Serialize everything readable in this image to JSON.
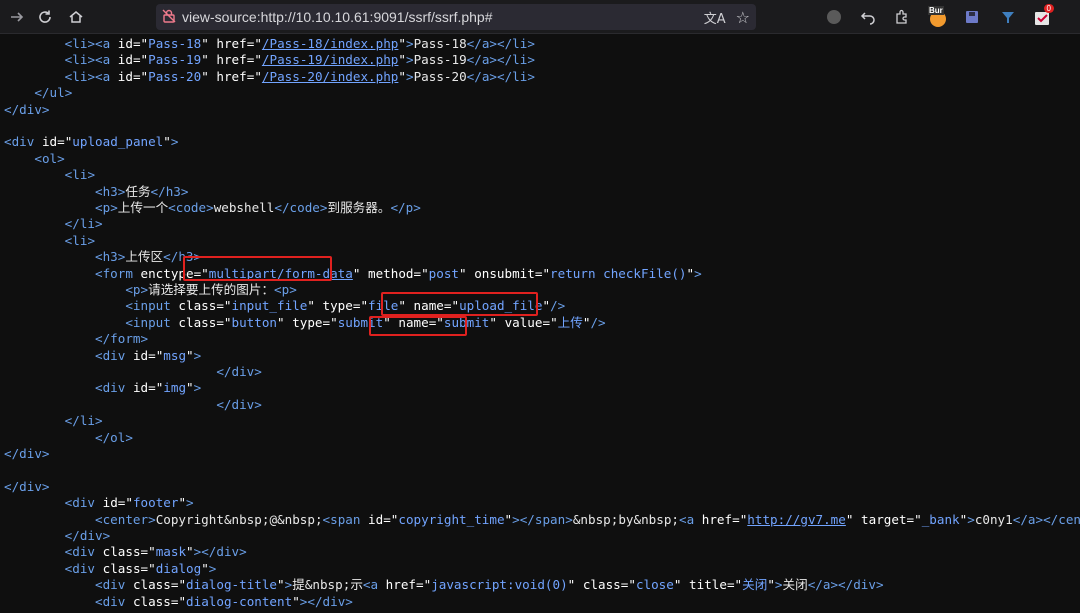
{
  "browser": {
    "url": "view-source:http://10.10.10.61:9091/ssrf/ssrf.php#",
    "extensions": [
      "Bur",
      "0"
    ]
  },
  "lines": [
    [
      [
        "        ",
        "tx"
      ],
      [
        "<",
        "t"
      ],
      [
        "li",
        "t"
      ],
      [
        ">",
        "t"
      ],
      [
        "<",
        "t"
      ],
      [
        "a ",
        "t"
      ],
      [
        "id",
        "a"
      ],
      [
        "=\"",
        "a"
      ],
      [
        "Pass-18",
        "v"
      ],
      [
        "\" ",
        "a"
      ],
      [
        "href",
        "a"
      ],
      [
        "=\"",
        "a"
      ],
      [
        "/Pass-18/index.php",
        "lk"
      ],
      [
        "\"",
        "a"
      ],
      [
        ">",
        "t"
      ],
      [
        "Pass-18",
        "tx"
      ],
      [
        "</",
        "t"
      ],
      [
        "a",
        "t"
      ],
      [
        "></",
        "t"
      ],
      [
        "li",
        "t"
      ],
      [
        ">",
        "t"
      ]
    ],
    [
      [
        "        ",
        "tx"
      ],
      [
        "<",
        "t"
      ],
      [
        "li",
        "t"
      ],
      [
        ">",
        "t"
      ],
      [
        "<",
        "t"
      ],
      [
        "a ",
        "t"
      ],
      [
        "id",
        "a"
      ],
      [
        "=\"",
        "a"
      ],
      [
        "Pass-19",
        "v"
      ],
      [
        "\" ",
        "a"
      ],
      [
        "href",
        "a"
      ],
      [
        "=\"",
        "a"
      ],
      [
        "/Pass-19/index.php",
        "lk"
      ],
      [
        "\"",
        "a"
      ],
      [
        ">",
        "t"
      ],
      [
        "Pass-19",
        "tx"
      ],
      [
        "</",
        "t"
      ],
      [
        "a",
        "t"
      ],
      [
        "></",
        "t"
      ],
      [
        "li",
        "t"
      ],
      [
        ">",
        "t"
      ]
    ],
    [
      [
        "        ",
        "tx"
      ],
      [
        "<",
        "t"
      ],
      [
        "li",
        "t"
      ],
      [
        ">",
        "t"
      ],
      [
        "<",
        "t"
      ],
      [
        "a ",
        "t"
      ],
      [
        "id",
        "a"
      ],
      [
        "=\"",
        "a"
      ],
      [
        "Pass-20",
        "v"
      ],
      [
        "\" ",
        "a"
      ],
      [
        "href",
        "a"
      ],
      [
        "=\"",
        "a"
      ],
      [
        "/Pass-20/index.php",
        "lk"
      ],
      [
        "\"",
        "a"
      ],
      [
        ">",
        "t"
      ],
      [
        "Pass-20",
        "tx"
      ],
      [
        "</",
        "t"
      ],
      [
        "a",
        "t"
      ],
      [
        "></",
        "t"
      ],
      [
        "li",
        "t"
      ],
      [
        ">",
        "t"
      ]
    ],
    [
      [
        "    ",
        "tx"
      ],
      [
        "</",
        "t"
      ],
      [
        "ul",
        "t"
      ],
      [
        ">",
        "t"
      ]
    ],
    [
      [
        "</",
        "t"
      ],
      [
        "div",
        "t"
      ],
      [
        ">",
        "t"
      ]
    ],
    [
      [
        "",
        "tx"
      ]
    ],
    [
      [
        "<",
        "t"
      ],
      [
        "div ",
        "t"
      ],
      [
        "id",
        "a"
      ],
      [
        "=\"",
        "a"
      ],
      [
        "upload_panel",
        "v"
      ],
      [
        "\"",
        "a"
      ],
      [
        ">",
        "t"
      ]
    ],
    [
      [
        "    ",
        "tx"
      ],
      [
        "<",
        "t"
      ],
      [
        "ol",
        "t"
      ],
      [
        ">",
        "t"
      ]
    ],
    [
      [
        "        ",
        "tx"
      ],
      [
        "<",
        "t"
      ],
      [
        "li",
        "t"
      ],
      [
        ">",
        "t"
      ]
    ],
    [
      [
        "            ",
        "tx"
      ],
      [
        "<",
        "t"
      ],
      [
        "h3",
        "t"
      ],
      [
        ">",
        "t"
      ],
      [
        "任务",
        "tx"
      ],
      [
        "</",
        "t"
      ],
      [
        "h3",
        "t"
      ],
      [
        ">",
        "t"
      ]
    ],
    [
      [
        "            ",
        "tx"
      ],
      [
        "<",
        "t"
      ],
      [
        "p",
        "t"
      ],
      [
        ">",
        "t"
      ],
      [
        "上传一个",
        "tx"
      ],
      [
        "<",
        "t"
      ],
      [
        "code",
        "t"
      ],
      [
        ">",
        "t"
      ],
      [
        "webshell",
        "tx"
      ],
      [
        "</",
        "t"
      ],
      [
        "code",
        "t"
      ],
      [
        ">",
        "t"
      ],
      [
        "到服务器。",
        "tx"
      ],
      [
        "</",
        "t"
      ],
      [
        "p",
        "t"
      ],
      [
        ">",
        "t"
      ]
    ],
    [
      [
        "        ",
        "tx"
      ],
      [
        "</",
        "t"
      ],
      [
        "li",
        "t"
      ],
      [
        ">",
        "t"
      ]
    ],
    [
      [
        "        ",
        "tx"
      ],
      [
        "<",
        "t"
      ],
      [
        "li",
        "t"
      ],
      [
        ">",
        "t"
      ]
    ],
    [
      [
        "            ",
        "tx"
      ],
      [
        "<",
        "t"
      ],
      [
        "h3",
        "t"
      ],
      [
        ">",
        "t"
      ],
      [
        "上传区",
        "tx"
      ],
      [
        "</",
        "t"
      ],
      [
        "h3",
        "t"
      ],
      [
        ">",
        "t"
      ]
    ],
    [
      [
        "            ",
        "tx"
      ],
      [
        "<",
        "t"
      ],
      [
        "form ",
        "t"
      ],
      [
        "enctype",
        "a"
      ],
      [
        "=\"",
        "a"
      ],
      [
        "multipart/form-data",
        "lk"
      ],
      [
        "\" ",
        "a"
      ],
      [
        "method",
        "a"
      ],
      [
        "=\"",
        "a"
      ],
      [
        "post",
        "v"
      ],
      [
        "\" ",
        "a"
      ],
      [
        "onsubmit",
        "a"
      ],
      [
        "=\"",
        "a"
      ],
      [
        "return checkFile()",
        "v"
      ],
      [
        "\"",
        "a"
      ],
      [
        ">",
        "t"
      ]
    ],
    [
      [
        "                ",
        "tx"
      ],
      [
        "<",
        "t"
      ],
      [
        "p",
        "t"
      ],
      [
        ">",
        "t"
      ],
      [
        "请选择要上传的图片：",
        "tx"
      ],
      [
        "<",
        "t"
      ],
      [
        "p",
        "t"
      ],
      [
        ">",
        "t"
      ]
    ],
    [
      [
        "                ",
        "tx"
      ],
      [
        "<",
        "t"
      ],
      [
        "input ",
        "t"
      ],
      [
        "class",
        "a"
      ],
      [
        "=\"",
        "a"
      ],
      [
        "input_file",
        "v"
      ],
      [
        "\" ",
        "a"
      ],
      [
        "type",
        "a"
      ],
      [
        "=\"",
        "a"
      ],
      [
        "file",
        "v"
      ],
      [
        "\" ",
        "a"
      ],
      [
        "name",
        "a"
      ],
      [
        "=\"",
        "a"
      ],
      [
        "upload_file",
        "v"
      ],
      [
        "\"",
        "a"
      ],
      [
        "/>",
        "t"
      ]
    ],
    [
      [
        "                ",
        "tx"
      ],
      [
        "<",
        "t"
      ],
      [
        "input ",
        "t"
      ],
      [
        "class",
        "a"
      ],
      [
        "=\"",
        "a"
      ],
      [
        "button",
        "v"
      ],
      [
        "\" ",
        "a"
      ],
      [
        "type",
        "a"
      ],
      [
        "=\"",
        "a"
      ],
      [
        "submit",
        "v"
      ],
      [
        "\" ",
        "a"
      ],
      [
        "name",
        "a"
      ],
      [
        "=\"",
        "a"
      ],
      [
        "submit",
        "v"
      ],
      [
        "\" ",
        "a"
      ],
      [
        "value",
        "a"
      ],
      [
        "=\"",
        "a"
      ],
      [
        "上传",
        "v"
      ],
      [
        "\"",
        "a"
      ],
      [
        "/>",
        "t"
      ]
    ],
    [
      [
        "            ",
        "tx"
      ],
      [
        "</",
        "t"
      ],
      [
        "form",
        "t"
      ],
      [
        ">",
        "t"
      ]
    ],
    [
      [
        "            ",
        "tx"
      ],
      [
        "<",
        "t"
      ],
      [
        "div ",
        "t"
      ],
      [
        "id",
        "a"
      ],
      [
        "=\"",
        "a"
      ],
      [
        "msg",
        "v"
      ],
      [
        "\"",
        "a"
      ],
      [
        ">",
        "t"
      ]
    ],
    [
      [
        "                            ",
        "tx"
      ],
      [
        "</",
        "t"
      ],
      [
        "div",
        "t"
      ],
      [
        ">",
        "t"
      ]
    ],
    [
      [
        "            ",
        "tx"
      ],
      [
        "<",
        "t"
      ],
      [
        "div ",
        "t"
      ],
      [
        "id",
        "a"
      ],
      [
        "=\"",
        "a"
      ],
      [
        "img",
        "v"
      ],
      [
        "\"",
        "a"
      ],
      [
        ">",
        "t"
      ]
    ],
    [
      [
        "                            ",
        "tx"
      ],
      [
        "</",
        "t"
      ],
      [
        "div",
        "t"
      ],
      [
        ">",
        "t"
      ]
    ],
    [
      [
        "        ",
        "tx"
      ],
      [
        "</",
        "t"
      ],
      [
        "li",
        "t"
      ],
      [
        ">",
        "t"
      ]
    ],
    [
      [
        "            ",
        "tx"
      ],
      [
        "</",
        "t"
      ],
      [
        "ol",
        "t"
      ],
      [
        ">",
        "t"
      ]
    ],
    [
      [
        "</",
        "t"
      ],
      [
        "div",
        "t"
      ],
      [
        ">",
        "t"
      ]
    ],
    [
      [
        "",
        "tx"
      ]
    ],
    [
      [
        "</",
        "t"
      ],
      [
        "div",
        "t"
      ],
      [
        ">",
        "t"
      ]
    ],
    [
      [
        "        ",
        "tx"
      ],
      [
        "<",
        "t"
      ],
      [
        "div ",
        "t"
      ],
      [
        "id",
        "a"
      ],
      [
        "=\"",
        "a"
      ],
      [
        "footer",
        "v"
      ],
      [
        "\"",
        "a"
      ],
      [
        ">",
        "t"
      ]
    ],
    [
      [
        "            ",
        "tx"
      ],
      [
        "<",
        "t"
      ],
      [
        "center",
        "t"
      ],
      [
        ">",
        "t"
      ],
      [
        "Copyright",
        "tx"
      ],
      [
        "&nbsp;",
        "tx"
      ],
      [
        "@",
        "tx"
      ],
      [
        "&nbsp;",
        "tx"
      ],
      [
        "<",
        "t"
      ],
      [
        "span ",
        "t"
      ],
      [
        "id",
        "a"
      ],
      [
        "=\"",
        "a"
      ],
      [
        "copyright_time",
        "v"
      ],
      [
        "\"",
        "a"
      ],
      [
        "></",
        "t"
      ],
      [
        "span",
        "t"
      ],
      [
        ">",
        "t"
      ],
      [
        "&nbsp;",
        "tx"
      ],
      [
        "by",
        "tx"
      ],
      [
        "&nbsp;",
        "tx"
      ],
      [
        "<",
        "t"
      ],
      [
        "a ",
        "t"
      ],
      [
        "href",
        "a"
      ],
      [
        "=\"",
        "a"
      ],
      [
        "http://gv7.me",
        "lk"
      ],
      [
        "\" ",
        "a"
      ],
      [
        "target",
        "a"
      ],
      [
        "=\"",
        "a"
      ],
      [
        "_bank",
        "v"
      ],
      [
        "\"",
        "a"
      ],
      [
        ">",
        "t"
      ],
      [
        "c0ny1",
        "tx"
      ],
      [
        "</",
        "t"
      ],
      [
        "a",
        "t"
      ],
      [
        "></",
        "t"
      ],
      [
        "center",
        "t"
      ],
      [
        ">",
        "t"
      ]
    ],
    [
      [
        "        ",
        "tx"
      ],
      [
        "</",
        "t"
      ],
      [
        "div",
        "t"
      ],
      [
        ">",
        "t"
      ]
    ],
    [
      [
        "        ",
        "tx"
      ],
      [
        "<",
        "t"
      ],
      [
        "div ",
        "t"
      ],
      [
        "class",
        "a"
      ],
      [
        "=\"",
        "a"
      ],
      [
        "mask",
        "v"
      ],
      [
        "\"",
        "a"
      ],
      [
        "></",
        "t"
      ],
      [
        "div",
        "t"
      ],
      [
        ">",
        "t"
      ]
    ],
    [
      [
        "        ",
        "tx"
      ],
      [
        "<",
        "t"
      ],
      [
        "div ",
        "t"
      ],
      [
        "class",
        "a"
      ],
      [
        "=\"",
        "a"
      ],
      [
        "dialog",
        "v"
      ],
      [
        "\"",
        "a"
      ],
      [
        ">",
        "t"
      ]
    ],
    [
      [
        "            ",
        "tx"
      ],
      [
        "<",
        "t"
      ],
      [
        "div ",
        "t"
      ],
      [
        "class",
        "a"
      ],
      [
        "=\"",
        "a"
      ],
      [
        "dialog-title",
        "v"
      ],
      [
        "\"",
        "a"
      ],
      [
        ">",
        "t"
      ],
      [
        "提",
        "tx"
      ],
      [
        "&nbsp;",
        "tx"
      ],
      [
        "示",
        "tx"
      ],
      [
        "<",
        "t"
      ],
      [
        "a ",
        "t"
      ],
      [
        "href",
        "a"
      ],
      [
        "=\"",
        "a"
      ],
      [
        "javascript:void(0)",
        "v"
      ],
      [
        "\" ",
        "a"
      ],
      [
        "class",
        "a"
      ],
      [
        "=\"",
        "a"
      ],
      [
        "close",
        "v"
      ],
      [
        "\" ",
        "a"
      ],
      [
        "title",
        "a"
      ],
      [
        "=\"",
        "a"
      ],
      [
        "关闭",
        "v"
      ],
      [
        "\"",
        "a"
      ],
      [
        ">",
        "t"
      ],
      [
        "关闭",
        "tx"
      ],
      [
        "</",
        "t"
      ],
      [
        "a",
        "t"
      ],
      [
        "></",
        "t"
      ],
      [
        "div",
        "t"
      ],
      [
        ">",
        "t"
      ]
    ],
    [
      [
        "            ",
        "tx"
      ],
      [
        "<",
        "t"
      ],
      [
        "div ",
        "t"
      ],
      [
        "class",
        "a"
      ],
      [
        "=\"",
        "a"
      ],
      [
        "dialog-content",
        "v"
      ],
      [
        "\"",
        "a"
      ],
      [
        "></",
        "t"
      ],
      [
        "div",
        "t"
      ],
      [
        ">",
        "t"
      ]
    ]
  ],
  "colors": {
    "highlight": "#e0211f",
    "tag": "#6a9fe8",
    "value": "#72a4ff"
  }
}
